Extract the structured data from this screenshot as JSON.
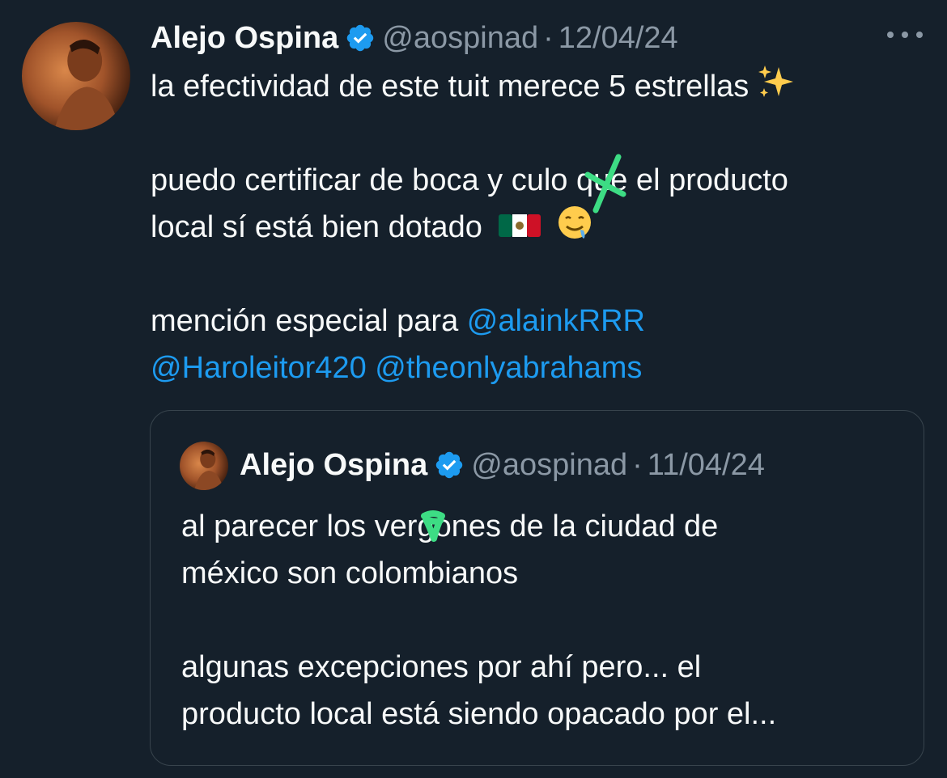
{
  "tweet": {
    "author_name": "Alejo Ospina",
    "handle": "@aospinad",
    "separator": "·",
    "date": "12/04/24",
    "line1": "la efectividad de este tuit merece 5 estrellas",
    "line2": "puedo certificar de boca y culo que el producto",
    "line3": "local sí está bien dotado",
    "line4_text": "mención especial para ",
    "mention1": "@alainkRRR",
    "mention2": "@Haroleitor420",
    "mention3": "@theonlyabrahams",
    "emojis": {
      "sparkles": "sparkles-emoji",
      "flag": "mexico-flag-emoji",
      "drool": "drooling-face-emoji"
    }
  },
  "quoted": {
    "author_name": "Alejo Ospina",
    "handle": "@aospinad",
    "separator": "·",
    "date": "11/04/24",
    "line1": "al parecer los vergones de la ciudad de",
    "line2": "méxico son colombianos",
    "line3": "algunas excepciones por ahí pero... el",
    "line4": "producto local está siendo opacado por el..."
  },
  "colors": {
    "background": "#15202b",
    "text": "#f7f9f9",
    "secondary": "#8b98a5",
    "link": "#1d9bf0",
    "verified": "#1d9bf0",
    "scribble": "#3ddc84",
    "border": "#38444d"
  },
  "icons": [
    "verified-badge-icon",
    "more-options-icon"
  ]
}
